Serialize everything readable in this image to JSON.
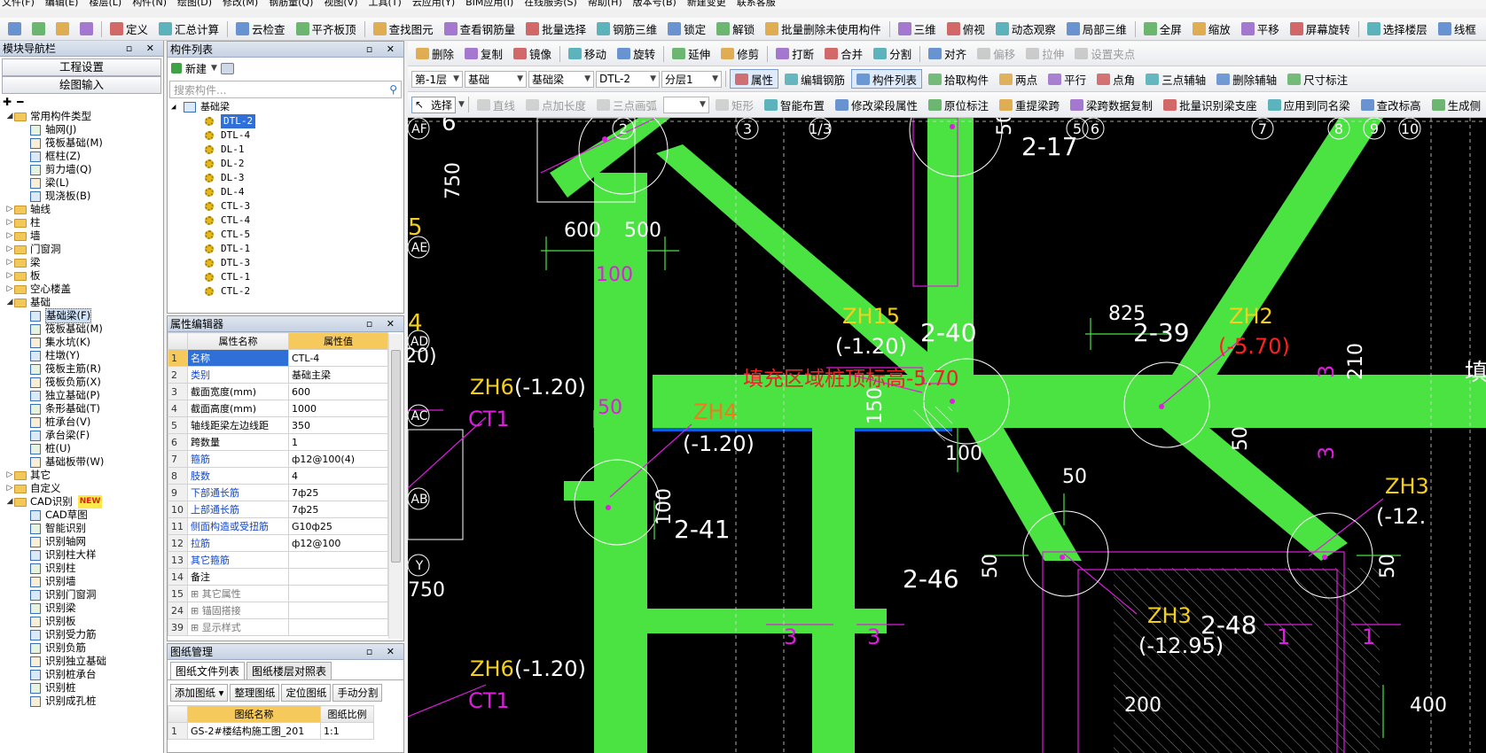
{
  "menubar": {
    "items": [
      "文件(F)",
      "编辑(E)",
      "楼层(L)",
      "构件(N)",
      "绘图(D)",
      "修改(M)",
      "钢筋量(Q)",
      "视图(V)",
      "工具(T)",
      "云应用(Y)",
      "BIM应用(I)",
      "在线服务(S)",
      "帮助(H)",
      "版本号(B)",
      "新建变更",
      "联系客服"
    ]
  },
  "toolbar1": [
    {
      "label": "",
      "icon": "open-icon"
    },
    {
      "label": "",
      "icon": "save-icon"
    },
    {
      "label": "",
      "icon": "undo-icon"
    },
    {
      "label": "",
      "icon": "redo-icon"
    },
    {
      "label": "定义",
      "icon": "define-icon"
    },
    {
      "label": "汇总计算",
      "icon": "sigma-icon"
    },
    {
      "label": "云检查",
      "icon": "cloud-check-icon"
    },
    {
      "label": "平齐板顶",
      "icon": "align-slab-icon"
    },
    {
      "label": "查找图元",
      "icon": "find-icon"
    },
    {
      "label": "查看钢筋量",
      "icon": "rebar-view-icon"
    },
    {
      "label": "批量选择",
      "icon": "batch-select-icon"
    },
    {
      "label": "钢筋三维",
      "icon": "rebar-3d-icon"
    },
    {
      "label": "锁定",
      "icon": "lock-icon"
    },
    {
      "label": "解锁",
      "icon": "unlock-icon"
    },
    {
      "label": "批量删除未使用构件",
      "icon": "batch-delete-icon"
    },
    {
      "label": "三维",
      "icon": "3d-icon"
    },
    {
      "label": "俯视",
      "icon": "top-view-icon"
    },
    {
      "label": "动态观察",
      "icon": "orbit-icon"
    },
    {
      "label": "局部三维",
      "icon": "local-3d-icon"
    },
    {
      "label": "全屏",
      "icon": "fullscreen-icon"
    },
    {
      "label": "缩放",
      "icon": "zoom-icon"
    },
    {
      "label": "平移",
      "icon": "pan-icon"
    },
    {
      "label": "屏幕旋转",
      "icon": "rotate-screen-icon"
    },
    {
      "label": "选择楼层",
      "icon": "select-floor-icon"
    },
    {
      "label": "线框",
      "icon": "wireframe-icon"
    }
  ],
  "nav": {
    "title": "模块导航栏",
    "buttons": [
      "工程设置",
      "绘图输入"
    ],
    "tree": [
      {
        "label": "常用构件类型",
        "level": 0,
        "expanded": true,
        "folder": true
      },
      {
        "label": "轴网(J)",
        "level": 1
      },
      {
        "label": "筏板基础(M)",
        "level": 1
      },
      {
        "label": "框柱(Z)",
        "level": 1
      },
      {
        "label": "剪力墙(Q)",
        "level": 1
      },
      {
        "label": "梁(L)",
        "level": 1
      },
      {
        "label": "现浇板(B)",
        "level": 1
      },
      {
        "label": "轴线",
        "level": 0,
        "folder": true
      },
      {
        "label": "柱",
        "level": 0,
        "folder": true
      },
      {
        "label": "墙",
        "level": 0,
        "folder": true
      },
      {
        "label": "门窗洞",
        "level": 0,
        "folder": true
      },
      {
        "label": "梁",
        "level": 0,
        "folder": true
      },
      {
        "label": "板",
        "level": 0,
        "folder": true
      },
      {
        "label": "空心楼盖",
        "level": 0,
        "folder": true
      },
      {
        "label": "基础",
        "level": 0,
        "expanded": true,
        "folder": true
      },
      {
        "label": "基础梁(F)",
        "level": 1,
        "selected": true
      },
      {
        "label": "筏板基础(M)",
        "level": 1
      },
      {
        "label": "集水坑(K)",
        "level": 1
      },
      {
        "label": "柱墩(Y)",
        "level": 1
      },
      {
        "label": "筏板主筋(R)",
        "level": 1
      },
      {
        "label": "筏板负筋(X)",
        "level": 1
      },
      {
        "label": "独立基础(P)",
        "level": 1
      },
      {
        "label": "条形基础(T)",
        "level": 1
      },
      {
        "label": "桩承台(V)",
        "level": 1
      },
      {
        "label": "承台梁(F)",
        "level": 1
      },
      {
        "label": "桩(U)",
        "level": 1
      },
      {
        "label": "基础板带(W)",
        "level": 1
      },
      {
        "label": "其它",
        "level": 0,
        "folder": true
      },
      {
        "label": "自定义",
        "level": 0,
        "folder": true
      },
      {
        "label": "CAD识别",
        "level": 0,
        "expanded": true,
        "folder": true,
        "badge": "NEW"
      },
      {
        "label": "CAD草图",
        "level": 1
      },
      {
        "label": "智能识别",
        "level": 1
      },
      {
        "label": "识别轴网",
        "level": 1
      },
      {
        "label": "识别柱大样",
        "level": 1
      },
      {
        "label": "识别柱",
        "level": 1
      },
      {
        "label": "识别墙",
        "level": 1
      },
      {
        "label": "识别门窗洞",
        "level": 1
      },
      {
        "label": "识别梁",
        "level": 1
      },
      {
        "label": "识别板",
        "level": 1
      },
      {
        "label": "识别受力筋",
        "level": 1
      },
      {
        "label": "识别负筋",
        "level": 1
      },
      {
        "label": "识别独立基础",
        "level": 1
      },
      {
        "label": "识别桩承台",
        "level": 1
      },
      {
        "label": "识别桩",
        "level": 1
      },
      {
        "label": "识别成孔桩",
        "level": 1
      }
    ]
  },
  "components": {
    "title": "构件列表",
    "new_label": "新建",
    "search_placeholder": "搜索构件...",
    "root": "基础梁",
    "items": [
      "DTL-2",
      "DTL-4",
      "DL-1",
      "DL-2",
      "DL-3",
      "DL-4",
      "CTL-3",
      "CTL-4",
      "CTL-5",
      "DTL-1",
      "DTL-3",
      "CTL-1",
      "CTL-2"
    ],
    "selected": "DTL-2"
  },
  "properties": {
    "title": "属性编辑器",
    "col_name": "属性名称",
    "col_value": "属性值",
    "rows": [
      {
        "n": "1",
        "name": "名称",
        "value": "CTL-4",
        "blue": true
      },
      {
        "n": "2",
        "name": "类别",
        "value": "基础主梁",
        "blue": true
      },
      {
        "n": "3",
        "name": "截面宽度(mm)",
        "value": "600"
      },
      {
        "n": "4",
        "name": "截面高度(mm)",
        "value": "1000"
      },
      {
        "n": "5",
        "name": "轴线距梁左边线距",
        "value": "350"
      },
      {
        "n": "6",
        "name": "跨数量",
        "value": "1"
      },
      {
        "n": "7",
        "name": "箍筋",
        "value": "ф12@100(4)",
        "blue": true
      },
      {
        "n": "8",
        "name": "肢数",
        "value": "4",
        "blue": true
      },
      {
        "n": "9",
        "name": "下部通长筋",
        "value": "7ф25",
        "blue": true
      },
      {
        "n": "10",
        "name": "上部通长筋",
        "value": "7ф25",
        "blue": true
      },
      {
        "n": "11",
        "name": "侧面构造或受扭筋",
        "value": "G10ф25",
        "blue": true
      },
      {
        "n": "12",
        "name": "拉筋",
        "value": "ф12@100",
        "blue": true
      },
      {
        "n": "13",
        "name": "其它箍筋",
        "value": "",
        "blue": true
      },
      {
        "n": "14",
        "name": "备注",
        "value": ""
      },
      {
        "n": "15",
        "name": "⊞ 其它属性",
        "value": "",
        "gray": true
      },
      {
        "n": "24",
        "name": "⊞ 锚固搭接",
        "value": "",
        "gray": true
      },
      {
        "n": "39",
        "name": "⊞ 显示样式",
        "value": "",
        "gray": true
      }
    ]
  },
  "drawings": {
    "title": "图纸管理",
    "tabs": [
      "图纸文件列表",
      "图纸楼层对照表"
    ],
    "buttons": [
      "添加图纸",
      "整理图纸",
      "定位图纸",
      "手动分割"
    ],
    "col_name": "图纸名称",
    "col_scale": "图纸比例",
    "rows": [
      {
        "n": "1",
        "name": "GS-2#楼结构施工图_201",
        "scale": "1:1"
      }
    ]
  },
  "cadbar1": [
    {
      "label": "删除",
      "icon": "delete-icon"
    },
    {
      "label": "复制",
      "icon": "copy-icon"
    },
    {
      "label": "镜像",
      "icon": "mirror-icon"
    },
    {
      "label": "移动",
      "icon": "move-icon"
    },
    {
      "label": "旋转",
      "icon": "rotate-icon"
    },
    {
      "label": "延伸",
      "icon": "extend-icon"
    },
    {
      "label": "修剪",
      "icon": "trim-icon"
    },
    {
      "label": "打断",
      "icon": "break-icon"
    },
    {
      "label": "合并",
      "icon": "merge-icon"
    },
    {
      "label": "分割",
      "icon": "split-icon"
    },
    {
      "label": "对齐",
      "icon": "align-icon"
    },
    {
      "label": "偏移",
      "icon": "offset-icon"
    },
    {
      "label": "拉伸",
      "icon": "stretch-icon"
    },
    {
      "label": "设置夹点",
      "icon": "grip-icon"
    }
  ],
  "cadbar2": {
    "floor": "第-1层",
    "category": "基础",
    "type": "基础梁",
    "component": "DTL-2",
    "layer": "分层1",
    "buttons": [
      "属性",
      "编辑钢筋",
      "构件列表",
      "拾取构件",
      "两点",
      "平行",
      "点角",
      "三点辅轴",
      "删除辅轴",
      "尺寸标注"
    ]
  },
  "cadbar3": {
    "select_label": "选择",
    "buttons": [
      "直线",
      "点加长度",
      "三点画弧",
      "矩形",
      "智能布置",
      "修改梁段属性",
      "原位标注",
      "重提梁跨",
      "梁跨数据复制",
      "批量识别梁支座",
      "应用到同名梁",
      "查改标高",
      "生成侧"
    ]
  },
  "cad": {
    "axis_top": [
      "2",
      "3",
      "1/3",
      "5",
      "6",
      "7",
      "8",
      "9",
      "10"
    ],
    "axis_left": [
      "AF",
      "AE",
      "AD",
      "AC",
      "AB",
      "Y"
    ],
    "beam_labels": [
      "2-17",
      "2-40",
      "2-39",
      "2-41",
      "2-46",
      "2-48"
    ],
    "pile_labels": [
      {
        "name": "ZH15",
        "elev": "(-1.20)"
      },
      {
        "name": "ZH2",
        "elev": "(-5.70)"
      },
      {
        "name": "ZH6",
        "elev": "(-1.20)"
      },
      {
        "name": "ZH4",
        "elev": "(-1.20)"
      },
      {
        "name": "ZH3",
        "elev": "(-12.95)"
      },
      {
        "name": "ZH3",
        "elev": "(-12."
      },
      {
        "name": "ZH6",
        "elev": "(-1.20)"
      }
    ],
    "fill_note": "填充区域桩顶标高-5.70",
    "ct_labels": [
      "CT1",
      "CT1"
    ],
    "dims": [
      "600",
      "500",
      "100",
      "750",
      "825",
      "150",
      "100",
      "50",
      "50",
      "50",
      "50",
      "100",
      "210",
      "200",
      "400",
      "50",
      "50",
      "750",
      "20)"
    ],
    "marks": [
      "3",
      "3",
      "3",
      "3",
      "1",
      "1"
    ],
    "left_cut": [
      "6",
      "5",
      "4",
      "填"
    ]
  },
  "colors": {
    "beam": "#4ae342",
    "canvas": "#000000",
    "fill": "#0a5fd8",
    "magenta": "#e01ce0",
    "cyan": "#3db2ff"
  }
}
